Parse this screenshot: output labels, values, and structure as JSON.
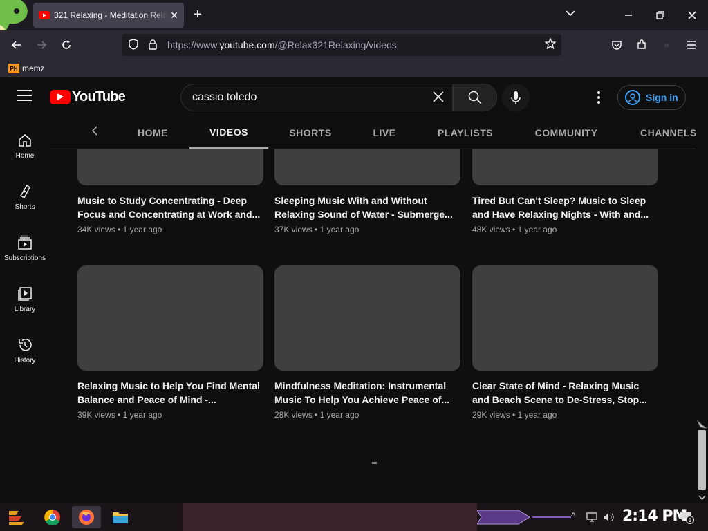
{
  "browser": {
    "tab_title": "321 Relaxing - Meditation Relax",
    "url_prefix": "https://www.",
    "url_domain": "youtube.com",
    "url_path": "/@Relax321Relaxing/videos",
    "bookmark_label": "memz",
    "bookmark_icon_text": "PH"
  },
  "youtube": {
    "logo_text": "YouTube",
    "search_query": "cassio toledo",
    "sign_in": "Sign in",
    "guide": [
      {
        "label": "Home"
      },
      {
        "label": "Shorts"
      },
      {
        "label": "Subscriptions"
      },
      {
        "label": "Library"
      },
      {
        "label": "History"
      }
    ],
    "tabs": [
      "HOME",
      "VIDEOS",
      "SHORTS",
      "LIVE",
      "PLAYLISTS",
      "COMMUNITY",
      "CHANNELS"
    ],
    "active_tab": "VIDEOS",
    "videos": [
      {
        "title": "Music to Study Concentrating - Deep Focus and Concentrating at Work and...",
        "views": "34K views",
        "age": "1 year ago"
      },
      {
        "title": "Sleeping Music With and Without Relaxing Sound of Water - Submerge...",
        "views": "37K views",
        "age": "1 year ago"
      },
      {
        "title": "Tired But Can't Sleep? Music to Sleep and Have Relaxing Nights - With and...",
        "views": "48K views",
        "age": "1 year ago"
      },
      {
        "title": "Relaxing Music to Help You Find Mental Balance and Peace of Mind -...",
        "views": "39K views",
        "age": "1 year ago"
      },
      {
        "title": "Mindfulness Meditation: Instrumental Music To Help You Achieve Peace of...",
        "views": "28K views",
        "age": "1 year ago"
      },
      {
        "title": "Clear State of Mind - Relaxing Music and Beach Scene to De-Stress, Stop...",
        "views": "29K views",
        "age": "1 year ago"
      }
    ],
    "meta_separator": "•"
  },
  "taskbar": {
    "clock": "2:14 PM",
    "notification_count": "1"
  },
  "colors": {
    "accent_blue": "#3ea6ff",
    "youtube_red": "#ff0000"
  }
}
